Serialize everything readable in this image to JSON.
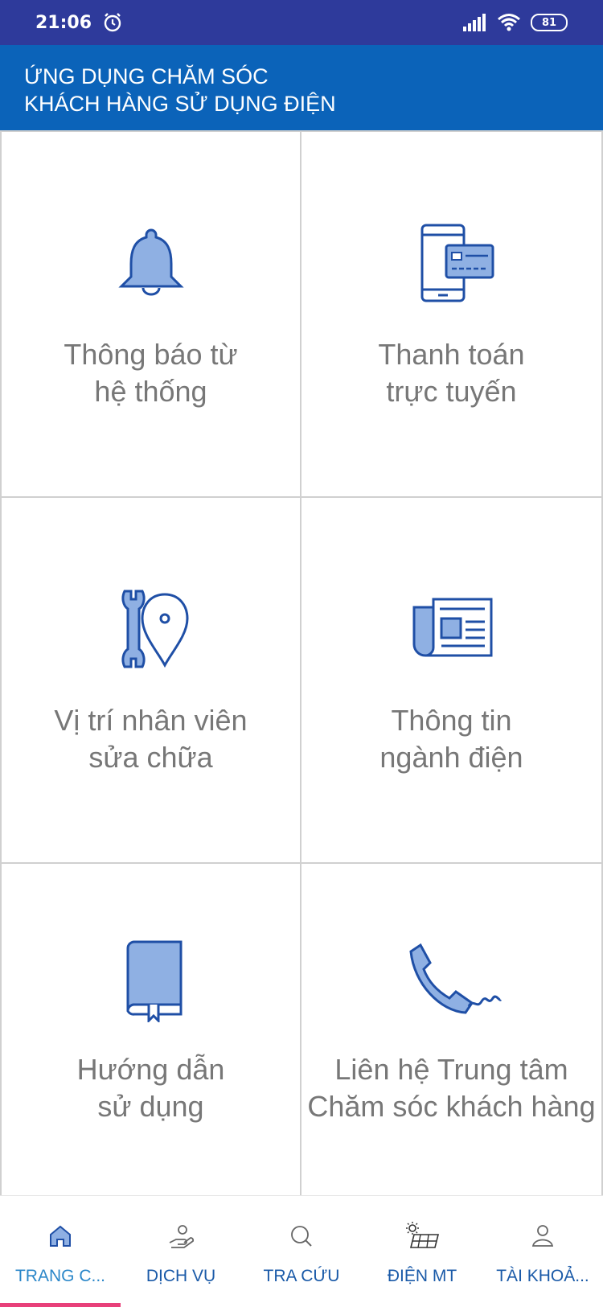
{
  "status_bar": {
    "time": "21:06",
    "battery": "81",
    "icons": [
      "alarm-icon",
      "signal-icon",
      "wifi-icon",
      "battery-icon"
    ]
  },
  "header": {
    "line1": "ỨNG DỤNG CHĂM SÓC",
    "line2": "KHÁCH HÀNG SỬ DỤNG ĐIỆN"
  },
  "tiles": [
    {
      "line1": "Thông báo từ",
      "line2": "hệ thống",
      "icon": "bell-icon"
    },
    {
      "line1": "Thanh toán",
      "line2": "trực tuyến",
      "icon": "phone-card-icon"
    },
    {
      "line1": "Vị trí nhân viên",
      "line2": "sửa chữa",
      "icon": "wrench-location-icon"
    },
    {
      "line1": "Thông tin",
      "line2": "ngành điện",
      "icon": "newspaper-icon"
    },
    {
      "line1": "Hướng dẫn",
      "line2": "sử dụng",
      "icon": "book-icon"
    },
    {
      "line1": "Liên hệ Trung tâm",
      "line2": "Chăm sóc khách hàng",
      "icon": "telephone-icon"
    }
  ],
  "bottom_nav": [
    {
      "label": "TRANG C...",
      "icon": "home-icon",
      "active": true
    },
    {
      "label": "DỊCH VỤ",
      "icon": "service-hand-icon"
    },
    {
      "label": "TRA CỨU",
      "icon": "search-icon"
    },
    {
      "label": "ĐIỆN MT",
      "icon": "solar-panel-icon"
    },
    {
      "label": "TÀI KHOẢ...",
      "icon": "user-icon"
    }
  ],
  "colors": {
    "status_bar": "#2e3a9b",
    "header": "#0b63b9",
    "icon_fill": "#8fb0e3",
    "icon_stroke": "#1f4fa6",
    "active_indicator": "#e8407a"
  }
}
